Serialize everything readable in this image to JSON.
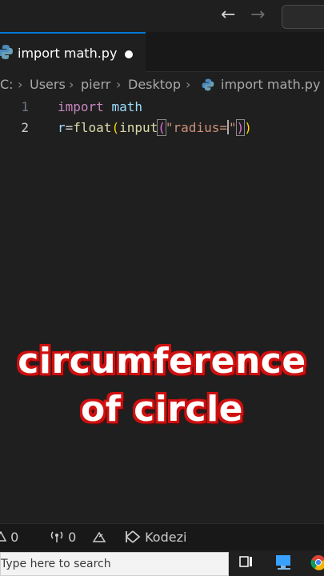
{
  "titlebar": {
    "back_icon": "arrow-left-icon",
    "forward_icon": "arrow-right-icon"
  },
  "tabs": [
    {
      "label": "import math.py",
      "dirty": true
    }
  ],
  "breadcrumb": {
    "drive": "C:",
    "items": [
      "Users",
      "pierr",
      "Desktop",
      "import math.py"
    ]
  },
  "editor": {
    "lines": [
      {
        "number": "1",
        "text": "import math"
      },
      {
        "number": "2",
        "text": "r=float(input(\"radius=\"))"
      }
    ]
  },
  "caption": {
    "line1": "circumference",
    "line2": "of circle"
  },
  "statusbar": {
    "errors": "0",
    "ports": "0",
    "extension": "Kodezi"
  },
  "taskbar": {
    "search_placeholder": "Type here to search"
  },
  "colors": {
    "accent": "#0078d4",
    "caption_outline": "#d01010",
    "keyword": "#c586c0",
    "string": "#ce9178",
    "function": "#dcdcaa",
    "variable": "#9cdcfe"
  }
}
